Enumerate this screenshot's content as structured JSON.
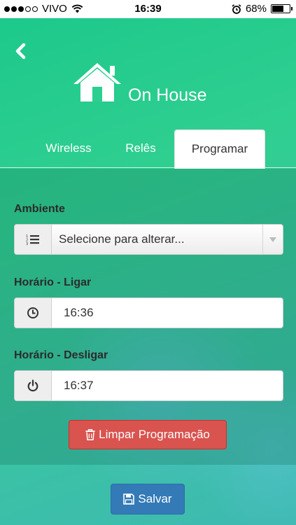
{
  "status_bar": {
    "carrier": "VIVO",
    "time": "16:39",
    "battery": "68%",
    "battery_level": 0.68
  },
  "header": {
    "title": "On House"
  },
  "tabs": [
    {
      "label": "Wireless"
    },
    {
      "label": "Relês"
    },
    {
      "label": "Programar"
    }
  ],
  "form": {
    "ambiente": {
      "label": "Ambiente",
      "value": "Selecione para alterar..."
    },
    "ligar": {
      "label": "Horário - Ligar",
      "value": "16:36"
    },
    "desligar": {
      "label": "Horário - Desligar",
      "value": "16:37"
    },
    "clear_button": "Limpar Programação"
  },
  "save_button": "Salvar",
  "colors": {
    "danger": "#d9534f",
    "primary": "#337ab7",
    "accent_green": "#1bc88b"
  },
  "icons": {
    "back": "chevron-left-icon",
    "brand": "house-icon",
    "ambiente": "ordered-list-icon",
    "ligar": "clock-icon",
    "desligar": "power-icon",
    "clear": "trash-icon",
    "save": "floppy-disk-icon"
  }
}
